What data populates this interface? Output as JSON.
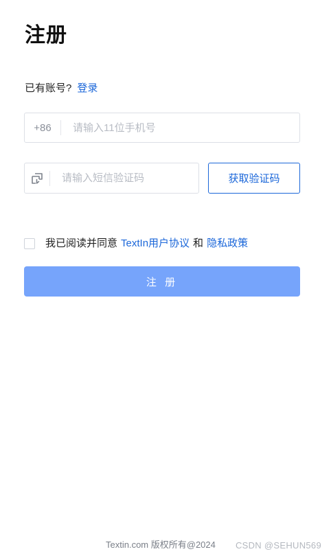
{
  "page": {
    "title": "注册"
  },
  "account_prompt": {
    "text": "已有账号?",
    "login_link": "登录"
  },
  "phone": {
    "country_code": "+86",
    "placeholder": "请输入11位手机号",
    "value": ""
  },
  "sms": {
    "icon": "sms-code-icon",
    "placeholder": "请输入短信验证码",
    "value": "",
    "get_code_label": "获取验证码"
  },
  "agreement": {
    "checked": false,
    "prefix": "我已阅读并同意",
    "user_agreement": "TextIn用户协议",
    "conjunction": "和",
    "privacy_policy": "隐私政策"
  },
  "register_button": {
    "label": "注 册"
  },
  "footer": {
    "copyright": "Textin.com 版权所有@2024",
    "watermark": "CSDN @SEHUN569"
  },
  "colors": {
    "accent": "#1a66d9",
    "button_disabled": "#76a4fb",
    "border": "#dcdfe6",
    "placeholder": "#b8bcc4"
  }
}
